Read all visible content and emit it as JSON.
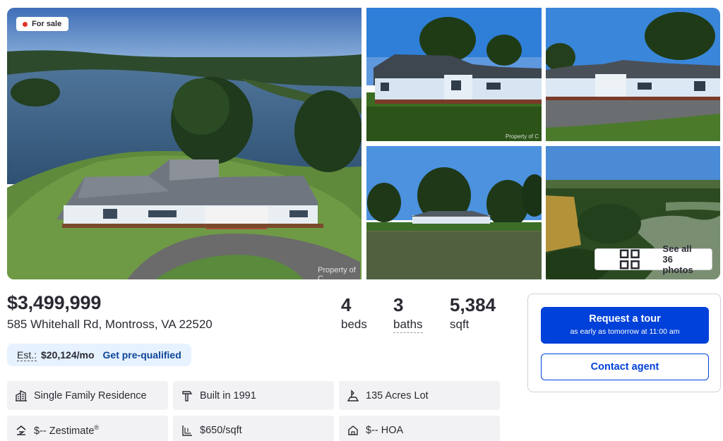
{
  "gallery": {
    "badge": "For sale",
    "watermark": "Property of C",
    "see_all": "See all 36 photos"
  },
  "listing": {
    "price": "$3,499,999",
    "address": "585 Whitehall Rd, Montross, VA 22520",
    "beds": {
      "value": "4",
      "label": "beds"
    },
    "baths": {
      "value": "3",
      "label": "baths"
    },
    "sqft": {
      "value": "5,384",
      "label": "sqft"
    }
  },
  "estimate": {
    "label": "Est.:",
    "value": "$20,124/mo",
    "link": "Get pre-qualified"
  },
  "facts": {
    "type": "Single Family Residence",
    "built": "Built in 1991",
    "lot": "135 Acres Lot",
    "zestimate": "$-- Zestimate",
    "zestimate_mark": "®",
    "price_sqft": "$650/sqft",
    "hoa": "$-- HOA"
  },
  "cta": {
    "tour_title": "Request a tour",
    "tour_sub": "as early as tomorrow at 11:00 am",
    "contact": "Contact agent"
  },
  "colors": {
    "primary": "#0041d9",
    "link": "#0d4599",
    "badge_dot": "#e0352b",
    "estimate_bg": "#e6f2ff",
    "fact_bg": "#f2f2f4"
  },
  "icons": [
    "building-icon",
    "hammer-icon",
    "lot-icon",
    "zestimate-icon",
    "price-per-sqft-icon",
    "hoa-icon",
    "grid-icon"
  ]
}
